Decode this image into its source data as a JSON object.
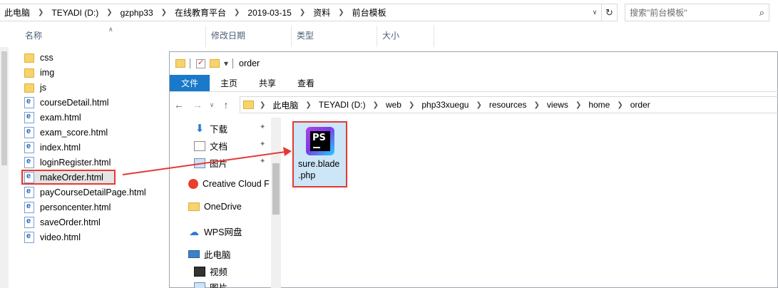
{
  "outer": {
    "breadcrumbs": [
      "此电脑",
      "TEYADI (D:)",
      "gzphp33",
      "在线教育平台",
      "2019-03-15",
      "资料",
      "前台模板"
    ],
    "search_placeholder": "搜索\"前台模板\"",
    "columns": [
      "名称",
      "修改日期",
      "类型",
      "大小"
    ],
    "files": [
      {
        "name": "css",
        "type": "folder"
      },
      {
        "name": "img",
        "type": "folder"
      },
      {
        "name": "js",
        "type": "folder"
      },
      {
        "name": "courseDetail.html",
        "type": "html"
      },
      {
        "name": "exam.html",
        "type": "html"
      },
      {
        "name": "exam_score.html",
        "type": "html"
      },
      {
        "name": "index.html",
        "type": "html"
      },
      {
        "name": "loginRegister.html",
        "type": "html"
      },
      {
        "name": "makeOrder.html",
        "type": "html",
        "highlighted": true
      },
      {
        "name": "payCourseDetailPage.html",
        "type": "html"
      },
      {
        "name": "personcenter.html",
        "type": "html"
      },
      {
        "name": "saveOrder.html",
        "type": "html"
      },
      {
        "name": "video.html",
        "type": "html"
      }
    ]
  },
  "inner": {
    "title": "order",
    "ribbon_tabs": [
      "文件",
      "主页",
      "共享",
      "查看"
    ],
    "breadcrumbs": [
      "此电脑",
      "TEYADI (D:)",
      "web",
      "php33xuegu",
      "resources",
      "views",
      "home",
      "order"
    ],
    "nav_items": [
      {
        "label": "下载",
        "icon": "download-arrow-icon",
        "pinned": true
      },
      {
        "label": "文档",
        "icon": "document-icon",
        "pinned": true
      },
      {
        "label": "图片",
        "icon": "pictures-icon",
        "pinned": true
      },
      {
        "label": "Creative Cloud F",
        "icon": "creative-cloud-icon",
        "pinned": false
      },
      {
        "label": "OneDrive",
        "icon": "folder-icon",
        "pinned": false
      },
      {
        "label": "WPS网盘",
        "icon": "cloud-icon",
        "pinned": false
      },
      {
        "label": "此电脑",
        "icon": "computer-icon",
        "pinned": false
      },
      {
        "label": "视频",
        "icon": "video-icon",
        "pinned": false
      },
      {
        "label": "图片",
        "icon": "pictures-icon",
        "pinned": false
      }
    ],
    "file": {
      "name_line1": "sure.blade",
      "name_line2": ".php",
      "logo_text": "PS",
      "icon": "phpstorm-icon"
    }
  },
  "colors": {
    "accent": "#1979ca",
    "highlight_border": "#e53935",
    "selected_bg": "#cde6f7"
  }
}
